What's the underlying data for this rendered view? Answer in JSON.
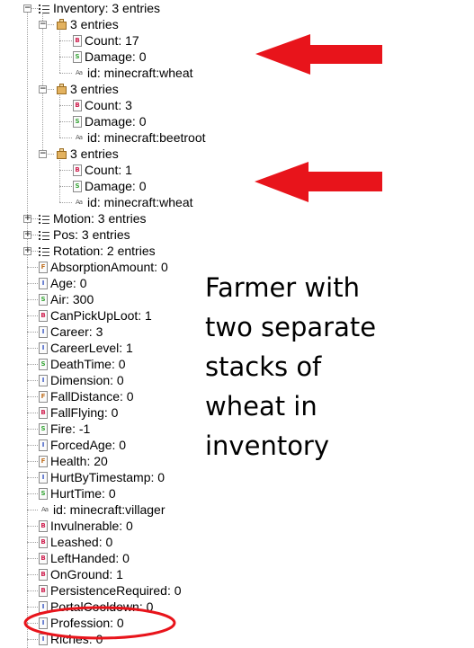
{
  "tree": [
    {
      "label": "Inventory: 3 entries",
      "icon": "list-icon",
      "kind": "list",
      "indent": 0,
      "expanded": true
    },
    {
      "label": "3 entries",
      "icon": "compound-icon",
      "kind": "cmp",
      "indent": 1,
      "expanded": true
    },
    {
      "label": "Count: 17",
      "icon": "byte-tag-icon",
      "kind": "tb",
      "glyph": "B",
      "indent": 2
    },
    {
      "label": "Damage: 0",
      "icon": "short-tag-icon",
      "kind": "ts",
      "glyph": "S",
      "indent": 2
    },
    {
      "label": "id: minecraft:wheat",
      "icon": "string-tag-icon",
      "kind": "str",
      "glyph": "Aa",
      "indent": 2
    },
    {
      "label": "3 entries",
      "icon": "compound-icon",
      "kind": "cmp",
      "indent": 1,
      "expanded": true
    },
    {
      "label": "Count: 3",
      "icon": "byte-tag-icon",
      "kind": "tb",
      "glyph": "B",
      "indent": 2
    },
    {
      "label": "Damage: 0",
      "icon": "short-tag-icon",
      "kind": "ts",
      "glyph": "S",
      "indent": 2
    },
    {
      "label": "id: minecraft:beetroot",
      "icon": "string-tag-icon",
      "kind": "str",
      "glyph": "Aa",
      "indent": 2
    },
    {
      "label": "3 entries",
      "icon": "compound-icon",
      "kind": "cmp",
      "indent": 1,
      "expanded": true
    },
    {
      "label": "Count: 1",
      "icon": "byte-tag-icon",
      "kind": "tb",
      "glyph": "B",
      "indent": 2
    },
    {
      "label": "Damage: 0",
      "icon": "short-tag-icon",
      "kind": "ts",
      "glyph": "S",
      "indent": 2
    },
    {
      "label": "id: minecraft:wheat",
      "icon": "string-tag-icon",
      "kind": "str",
      "glyph": "Aa",
      "indent": 2
    },
    {
      "label": "Motion: 3 entries",
      "icon": "list-icon",
      "kind": "list",
      "indent": 0,
      "expanded": false
    },
    {
      "label": "Pos: 3 entries",
      "icon": "list-icon",
      "kind": "list",
      "indent": 0,
      "expanded": false
    },
    {
      "label": "Rotation: 2 entries",
      "icon": "list-icon",
      "kind": "list",
      "indent": 0,
      "expanded": false
    },
    {
      "label": "AbsorptionAmount: 0",
      "icon": "float-tag-icon",
      "kind": "tf",
      "glyph": "F",
      "indent": 0
    },
    {
      "label": "Age: 0",
      "icon": "int-tag-icon",
      "kind": "ti",
      "glyph": "I",
      "indent": 0
    },
    {
      "label": "Air: 300",
      "icon": "short-tag-icon",
      "kind": "ts",
      "glyph": "S",
      "indent": 0
    },
    {
      "label": "CanPickUpLoot: 1",
      "icon": "byte-tag-icon",
      "kind": "tb",
      "glyph": "B",
      "indent": 0
    },
    {
      "label": "Career: 3",
      "icon": "int-tag-icon",
      "kind": "ti",
      "glyph": "I",
      "indent": 0
    },
    {
      "label": "CareerLevel: 1",
      "icon": "int-tag-icon",
      "kind": "ti",
      "glyph": "I",
      "indent": 0
    },
    {
      "label": "DeathTime: 0",
      "icon": "short-tag-icon",
      "kind": "ts",
      "glyph": "S",
      "indent": 0
    },
    {
      "label": "Dimension: 0",
      "icon": "int-tag-icon",
      "kind": "ti",
      "glyph": "I",
      "indent": 0
    },
    {
      "label": "FallDistance: 0",
      "icon": "float-tag-icon",
      "kind": "tf",
      "glyph": "F",
      "indent": 0
    },
    {
      "label": "FallFlying: 0",
      "icon": "byte-tag-icon",
      "kind": "tb",
      "glyph": "B",
      "indent": 0
    },
    {
      "label": "Fire: -1",
      "icon": "short-tag-icon",
      "kind": "ts",
      "glyph": "S",
      "indent": 0
    },
    {
      "label": "ForcedAge: 0",
      "icon": "int-tag-icon",
      "kind": "ti",
      "glyph": "I",
      "indent": 0
    },
    {
      "label": "Health: 20",
      "icon": "float-tag-icon",
      "kind": "tf",
      "glyph": "F",
      "indent": 0
    },
    {
      "label": "HurtByTimestamp: 0",
      "icon": "int-tag-icon",
      "kind": "ti",
      "glyph": "I",
      "indent": 0
    },
    {
      "label": "HurtTime: 0",
      "icon": "short-tag-icon",
      "kind": "ts",
      "glyph": "S",
      "indent": 0
    },
    {
      "label": "id: minecraft:villager",
      "icon": "string-tag-icon",
      "kind": "str",
      "glyph": "Aa",
      "indent": 0
    },
    {
      "label": "Invulnerable: 0",
      "icon": "byte-tag-icon",
      "kind": "tb",
      "glyph": "B",
      "indent": 0
    },
    {
      "label": "Leashed: 0",
      "icon": "byte-tag-icon",
      "kind": "tb",
      "glyph": "B",
      "indent": 0
    },
    {
      "label": "LeftHanded: 0",
      "icon": "byte-tag-icon",
      "kind": "tb",
      "glyph": "B",
      "indent": 0
    },
    {
      "label": "OnGround: 1",
      "icon": "byte-tag-icon",
      "kind": "tb",
      "glyph": "B",
      "indent": 0
    },
    {
      "label": "PersistenceRequired: 0",
      "icon": "byte-tag-icon",
      "kind": "tb",
      "glyph": "B",
      "indent": 0
    },
    {
      "label": "PortalCooldown: 0",
      "icon": "int-tag-icon",
      "kind": "ti",
      "glyph": "I",
      "indent": 0
    },
    {
      "label": "Profession: 0",
      "icon": "int-tag-icon",
      "kind": "ti",
      "glyph": "I",
      "indent": 0
    },
    {
      "label": "Riches: 0",
      "icon": "int-tag-icon",
      "kind": "ti",
      "glyph": "I",
      "indent": 0
    }
  ],
  "annotation": {
    "text": "Farmer with\ntwo separate\nstacks of\nwheat in\ninventory",
    "arrow_color": "#e8141b",
    "circle_color": "#e8141b"
  }
}
